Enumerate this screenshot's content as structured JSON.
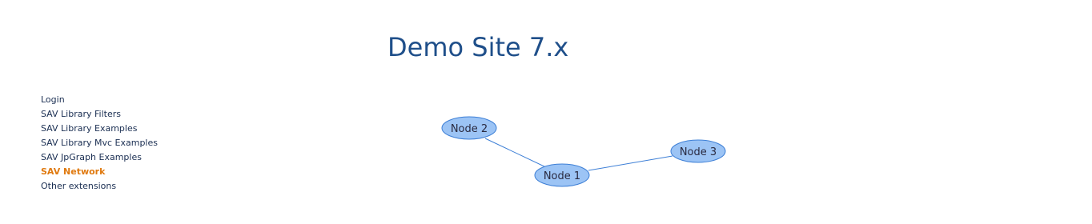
{
  "header": {
    "title": "Demo Site 7.x"
  },
  "nav": {
    "items": [
      {
        "label": "Login",
        "active": false
      },
      {
        "label": "SAV Library Filters",
        "active": false
      },
      {
        "label": "SAV Library Examples",
        "active": false
      },
      {
        "label": "SAV Library Mvc Examples",
        "active": false
      },
      {
        "label": "SAV JpGraph Examples",
        "active": false
      },
      {
        "label": "SAV Network",
        "active": true
      },
      {
        "label": "Other extensions",
        "active": false
      }
    ]
  },
  "network": {
    "nodes": [
      {
        "id": "node1",
        "label": "Node 1"
      },
      {
        "id": "node2",
        "label": "Node 2"
      },
      {
        "id": "node3",
        "label": "Node 3"
      }
    ],
    "edges": [
      {
        "from": "node2",
        "to": "node1"
      },
      {
        "from": "node1",
        "to": "node3"
      }
    ],
    "colors": {
      "node_fill": "#9cc4f5",
      "node_stroke": "#3d7fd6",
      "edge": "#3d7fd6"
    }
  },
  "colors": {
    "title": "#1f4f8a",
    "nav_text": "#1a2e52",
    "nav_active": "#e07a10"
  }
}
